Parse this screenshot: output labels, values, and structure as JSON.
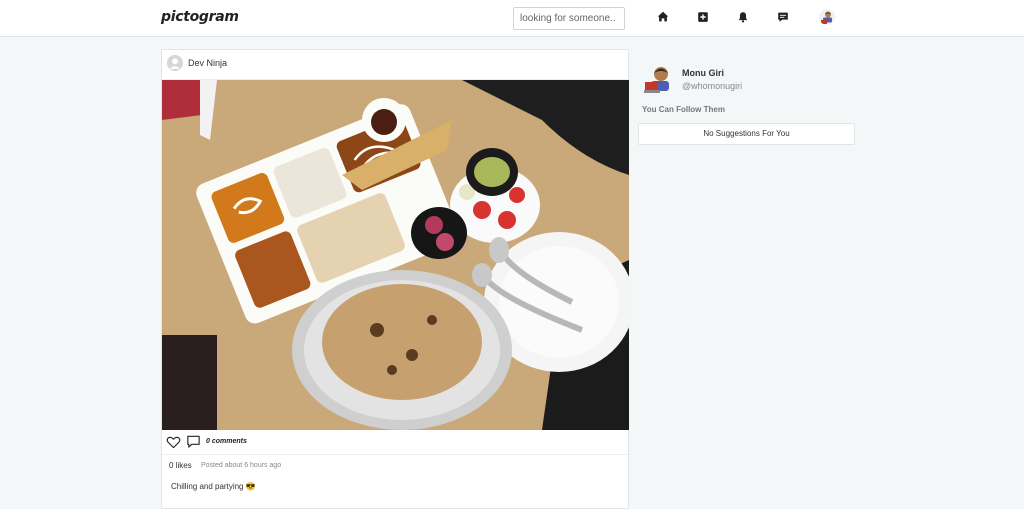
{
  "navbar": {
    "logo": "pictogram",
    "search": {
      "placeholder": "looking for someone.."
    },
    "icons": [
      "home-icon",
      "add-post-icon",
      "bell-icon",
      "messages-icon"
    ]
  },
  "post": {
    "username": "Dev Ninja",
    "comments_label": "0 comments",
    "likes_label": "0 likes",
    "posted_label": "Posted about 6 hours ago",
    "caption": "Chilling and partying 😎"
  },
  "sidebar": {
    "profile_name": "Monu Giri",
    "profile_handle": "@whomonugiri",
    "follow_heading": "You Can Follow Them",
    "suggestions_empty": "No Suggestions For You"
  },
  "colors": {
    "background": "#f3f7f8",
    "card": "#ffffff",
    "border": "#e1e5e8"
  }
}
